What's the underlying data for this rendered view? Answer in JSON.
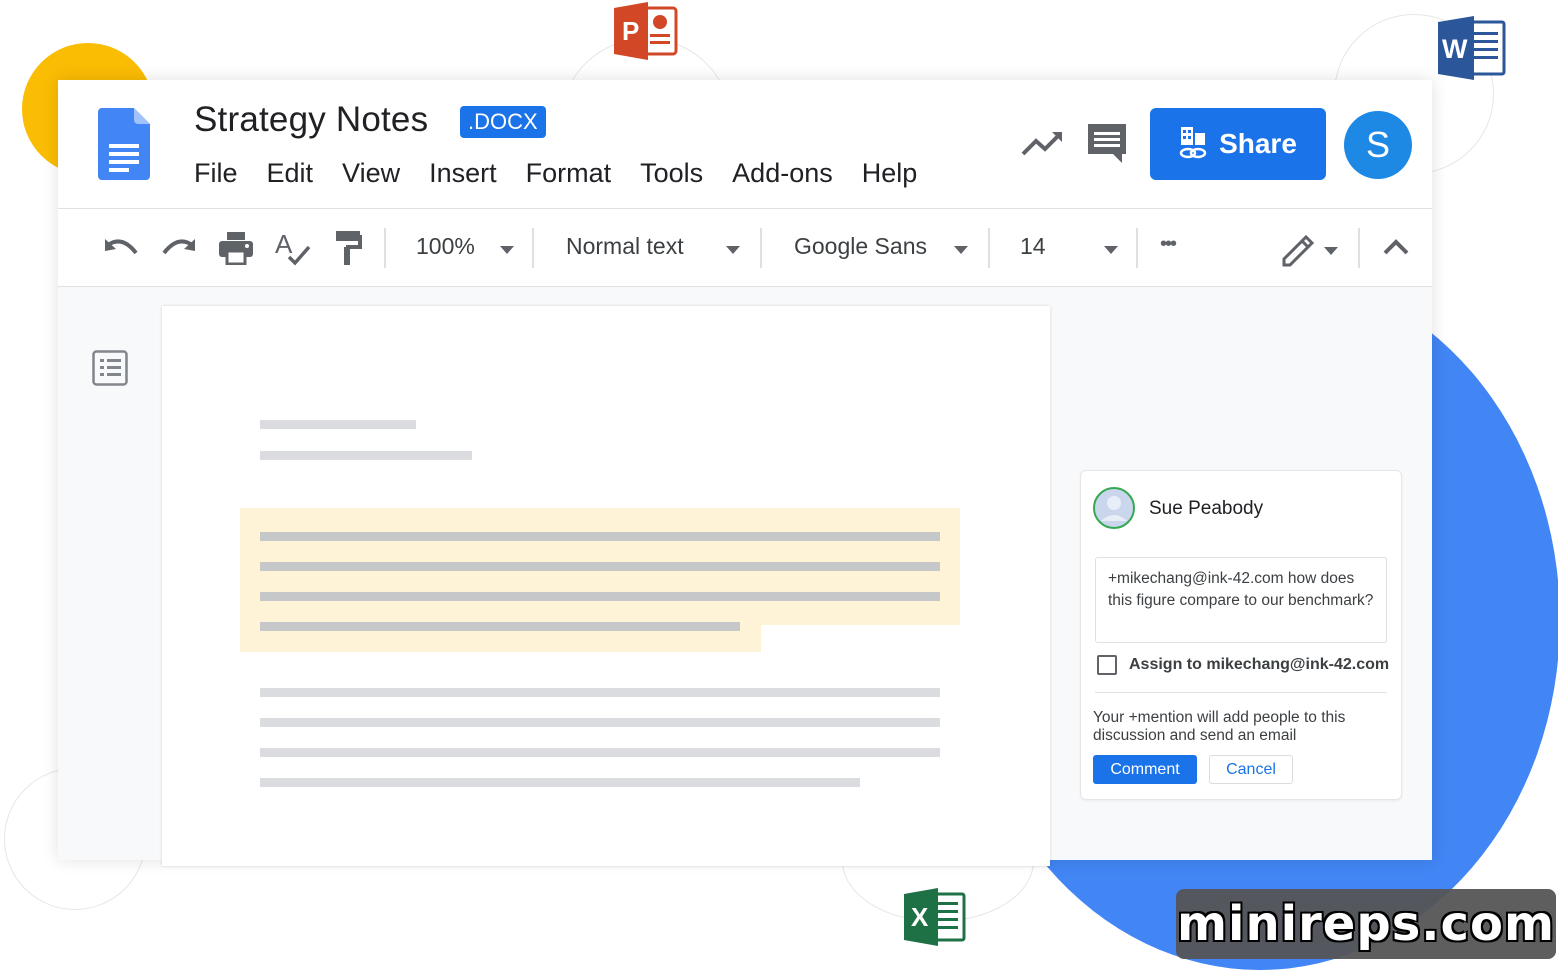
{
  "document": {
    "title": "Strategy Notes",
    "extension_badge": ".DOCX"
  },
  "menu": [
    "File",
    "Edit",
    "View",
    "Insert",
    "Format",
    "Tools",
    "Add-ons",
    "Help"
  ],
  "header": {
    "share_label": "Share",
    "avatar_initial": "S",
    "share_color": "#1a73e8",
    "avatar_color": "#1e88e5"
  },
  "toolbar": {
    "zoom": "100%",
    "style": "Normal text",
    "font": "Google Sans",
    "font_size": "14",
    "more": "•••"
  },
  "comment": {
    "author": "Sue Peabody",
    "text": "+mikechang@ink-42.com how does this figure compare to our benchmark?",
    "assign_label": "Assign to mikechang@ink-42.com",
    "assign_checked": false,
    "note": "Your +mention will add people to this discussion and send an email",
    "comment_button": "Comment",
    "cancel_button": "Cancel"
  },
  "app_badges": [
    {
      "name": "powerpoint",
      "letter": "P",
      "color": "#d24726"
    },
    {
      "name": "word",
      "letter": "W",
      "color": "#2b579a"
    },
    {
      "name": "excel",
      "letter": "X",
      "color": "#1e7145"
    }
  ],
  "highlight_color": "#fef3d6",
  "watermark": "minireps.com"
}
